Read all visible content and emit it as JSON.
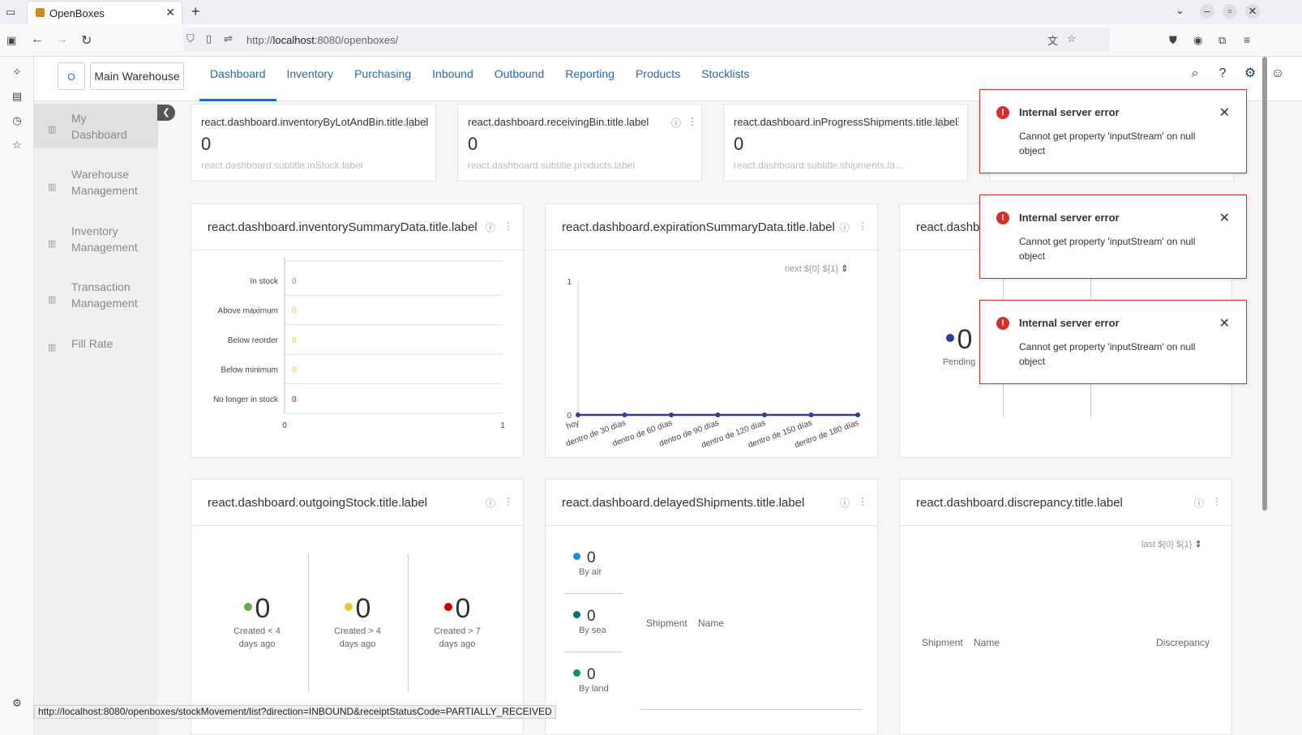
{
  "browser": {
    "tab_title": "OpenBoxes",
    "url_prefix": "http://",
    "url_host": "localhost",
    "url_rest": ":8080/openboxes/",
    "status_url": "http://localhost:8080/openboxes/stockMovement/list?direction=INBOUND&receiptStatusCode=PARTIALLY_RECEIVED"
  },
  "app": {
    "logo_text": "O",
    "warehouse": "Main Warehouse",
    "menu": [
      "Dashboard",
      "Inventory",
      "Purchasing",
      "Inbound",
      "Outbound",
      "Reporting",
      "Products",
      "Stocklists"
    ],
    "active_menu": "Dashboard"
  },
  "sidebar": {
    "items": [
      {
        "l1": "My",
        "l2": "Dashboard"
      },
      {
        "l1": "Warehouse",
        "l2": "Management"
      },
      {
        "l1": "Inventory",
        "l2": "Management"
      },
      {
        "l1": "Transaction",
        "l2": "Management"
      },
      {
        "l1": "Fill Rate",
        "l2": ""
      }
    ]
  },
  "number_cards": [
    {
      "title": "react.dashboard.inventoryByLotAndBin.title.label",
      "value": "0",
      "subtitle": "react.dashboard.subtitle.inStock.label"
    },
    {
      "title": "react.dashboard.receivingBin.title.label",
      "value": "0",
      "subtitle": "react.dashboard.subtitle.products.label"
    },
    {
      "title": "react.dashboard.inProgressShipments.title.label",
      "value": "0",
      "subtitle": "react.dashboard.subtitle.shipments.la..."
    }
  ],
  "cards": {
    "inventory_summary": {
      "title": "react.dashboard.inventorySummaryData.title.label"
    },
    "expiration_summary": {
      "title": "react.dashboard.expirationSummaryData.title.label",
      "filter": "next ${0} ${1}"
    },
    "third": {
      "title": "react.dashbo",
      "value": "0",
      "label": "Pending"
    },
    "outgoing": {
      "title": "react.dashboard.outgoingStock.title.label"
    },
    "delayed": {
      "title": "react.dashboard.delayedShipments.title.label",
      "col_shipment": "Shipment",
      "col_name": "Name"
    },
    "discrepancy": {
      "title": "react.dashboard.discrepancy.title.label",
      "filter": "last ${0} ${1}",
      "col_shipment": "Shipment",
      "col_name": "Name",
      "col_discrepancy": "Discrepancy"
    }
  },
  "chart_data": [
    {
      "type": "bar",
      "orientation": "horizontal",
      "categories": [
        "In stock",
        "Above maximum",
        "Below reorder",
        "Below minimum",
        "No longer in stock"
      ],
      "values": [
        0,
        0,
        0,
        0,
        0
      ],
      "value_colors": [
        "#6aa84f",
        "#f1c232",
        "#f1c232",
        "#f1c232",
        "#cc0000"
      ],
      "xlim": [
        0,
        1
      ],
      "x_ticks": [
        "0",
        "1"
      ]
    },
    {
      "type": "line",
      "categories": [
        "hoy",
        "dentro de 30 días",
        "dentro de 60 días",
        "dentro de 90 días",
        "dentro de 120 días",
        "dentro de 150 días",
        "dentro de 180 días"
      ],
      "series": [
        {
          "values": [
            0,
            0,
            0,
            0,
            0,
            0,
            0
          ]
        }
      ],
      "ylim": [
        0,
        1
      ],
      "y_ticks": [
        "0",
        "1"
      ],
      "color": "#2c3e9e"
    }
  ],
  "outgoing_stats": [
    {
      "value": "0",
      "l1": "Created < 4",
      "l2": "days ago",
      "color": "#6aa84f"
    },
    {
      "value": "0",
      "l1": "Created > 4",
      "l2": "days ago",
      "color": "#f1c232"
    },
    {
      "value": "0",
      "l1": "Created > 7",
      "l2": "days ago",
      "color": "#cc0000"
    }
  ],
  "delayed_stats": [
    {
      "value": "0",
      "label": "By air",
      "color": "#1a8fd4"
    },
    {
      "value": "0",
      "label": "By sea",
      "color": "#0e6e78"
    },
    {
      "value": "0",
      "label": "By land",
      "color": "#128a73"
    }
  ],
  "toasts": [
    {
      "title": "Internal server error",
      "message": "Cannot get property 'inputStream' on null object"
    },
    {
      "title": "Internal server error",
      "message": "Cannot get property 'inputStream' on null object"
    },
    {
      "title": "Internal server error",
      "message": "Cannot get property 'inputStream' on null object"
    }
  ]
}
